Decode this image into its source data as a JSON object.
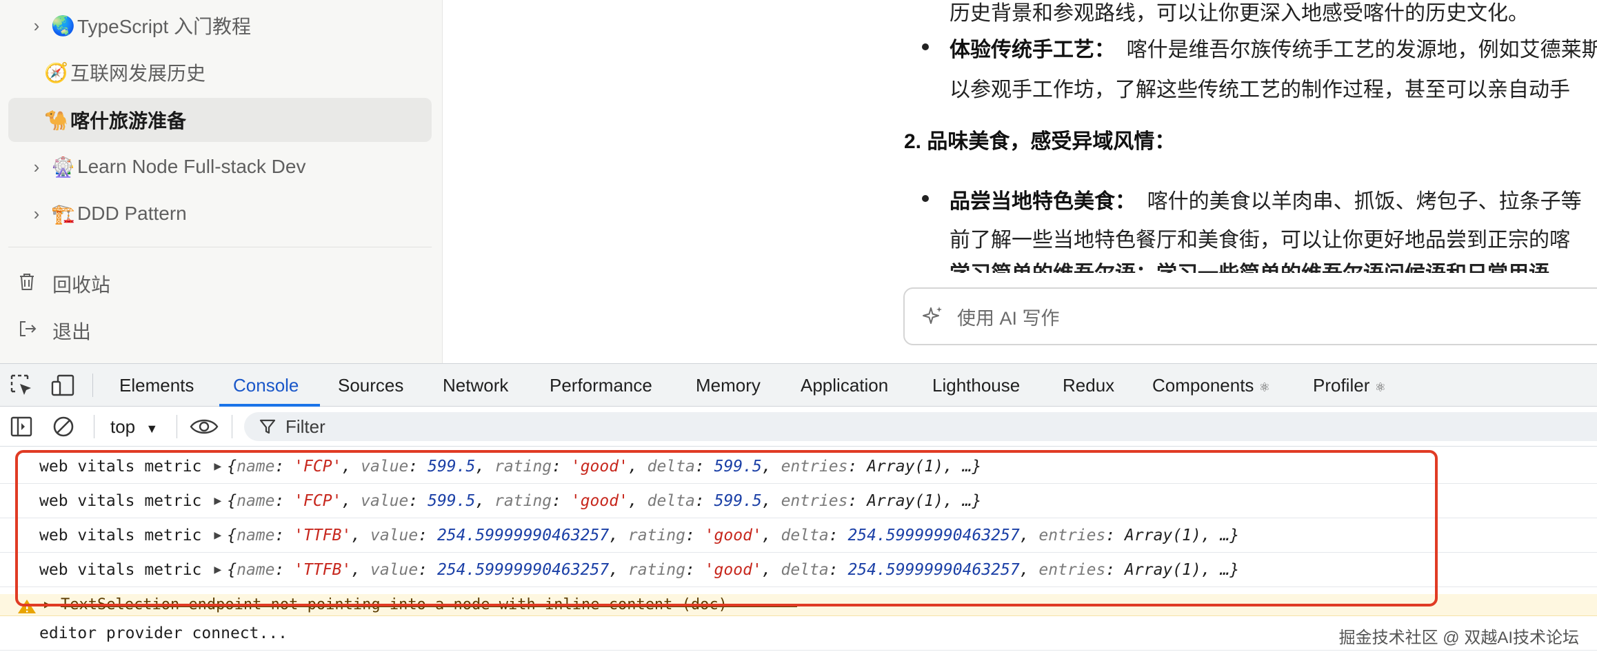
{
  "sidebar": {
    "items": [
      {
        "label": "TypeScript 入门教程",
        "emoji": "🌏",
        "expandable": true
      },
      {
        "label": "互联网发展历史",
        "emoji": "🧭",
        "expandable": false
      },
      {
        "label": "喀什旅游准备",
        "emoji": "🐪",
        "expandable": false,
        "active": true
      },
      {
        "label": "Learn Node Full-stack Dev",
        "emoji": "🎡",
        "expandable": true
      },
      {
        "label": "DDD Pattern",
        "emoji": "🏗️",
        "expandable": true
      }
    ],
    "trash_label": "回收站",
    "logout_label": "退出"
  },
  "content": {
    "line1": "历史背景和参观路线，可以让你更深入地感受喀什的历史文化。",
    "bullet1_title": "体验传统手工艺：",
    "bullet1_text": "喀什是维吾尔族传统手工艺的发源地，例如艾德莱斯绸",
    "bullet1_text2": "以参观手工作坊，了解这些传统工艺的制作过程，甚至可以亲自动手",
    "heading2": "2. 品味美食，感受异域风情：",
    "bullet2_title": "品尝当地特色美食：",
    "bullet2_text": "喀什的美食以羊肉串、抓饭、烤包子、拉条子等",
    "bullet2_text2": "前了解一些当地特色餐厅和美食街，可以让你更好地品尝到正宗的喀",
    "bullet3_partial": "学习简单的维吾尔语：学习一些简单的维吾尔语问候语和日常用语",
    "ai_placeholder": "使用 AI 写作"
  },
  "devtools": {
    "tabs": [
      "Elements",
      "Console",
      "Sources",
      "Network",
      "Performance",
      "Memory",
      "Application",
      "Lighthouse",
      "Redux",
      "Components",
      "Profiler"
    ],
    "active_tab": "Console",
    "react_mark": "⚛",
    "context": "top",
    "filter_label": "Filter",
    "logs": [
      {
        "msg": "web vitals metric",
        "name": "'FCP'",
        "value": "599.5",
        "rating": "'good'",
        "delta": "599.5",
        "entries": "Array(1)"
      },
      {
        "msg": "web vitals metric",
        "name": "'FCP'",
        "value": "599.5",
        "rating": "'good'",
        "delta": "599.5",
        "entries": "Array(1)"
      },
      {
        "msg": "web vitals metric",
        "name": "'TTFB'",
        "value": "254.59999990463257",
        "rating": "'good'",
        "delta": "254.59999990463257",
        "entries": "Array(1)"
      },
      {
        "msg": "web vitals metric",
        "name": "'TTFB'",
        "value": "254.59999990463257",
        "rating": "'good'",
        "delta": "254.59999990463257",
        "entries": "Array(1)"
      }
    ],
    "warning": "TextSelection endpoint not pointing into a node with inline content (doc)",
    "last_log": "editor provider connect..."
  },
  "watermark": "掘金技术社区 @ 双越AI技术论坛",
  "colors": {
    "accent": "#1a73e8",
    "highlight_box": "#e03b24",
    "string": "#c7271d",
    "number": "#1a3fa6"
  }
}
